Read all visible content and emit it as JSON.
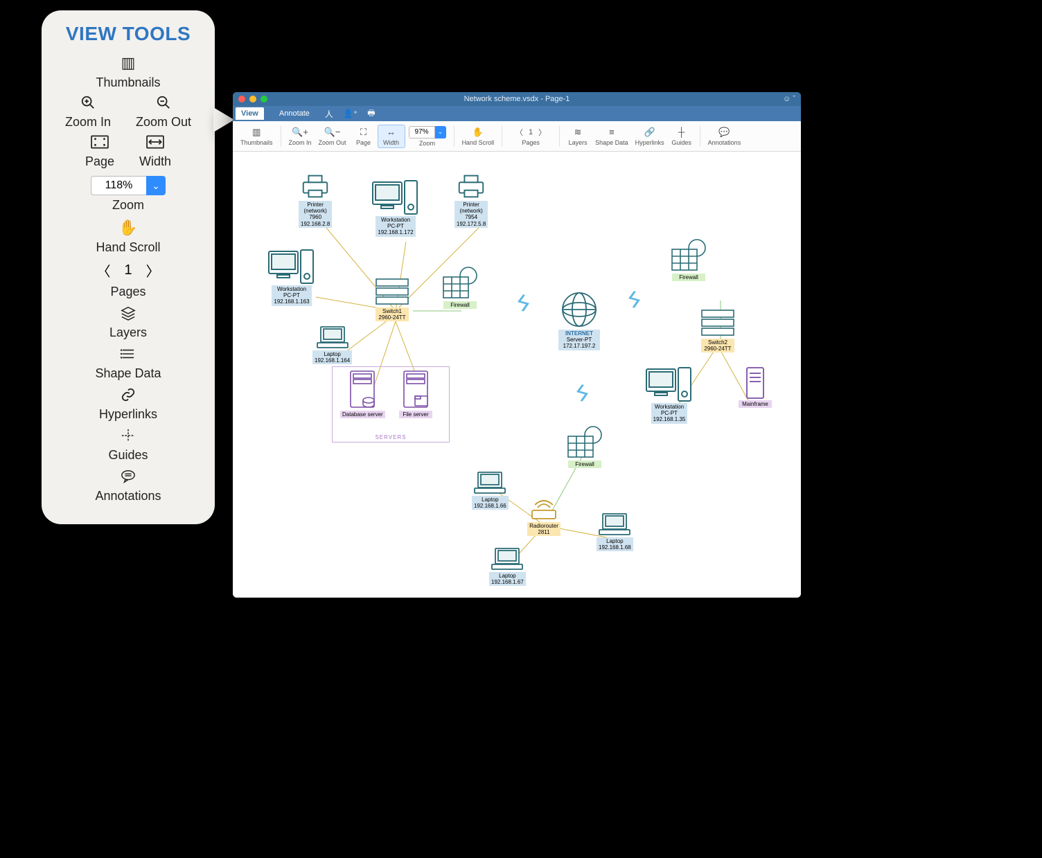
{
  "callout": {
    "title": "VIEW TOOLS",
    "thumbnails": "Thumbnails",
    "zoom_in": "Zoom In",
    "zoom_out": "Zoom Out",
    "page": "Page",
    "width": "Width",
    "zoom_value": "118%",
    "zoom_label": "Zoom",
    "hand_scroll": "Hand Scroll",
    "page_number": "1",
    "pages": "Pages",
    "layers": "Layers",
    "shape_data": "Shape Data",
    "hyperlinks": "Hyperlinks",
    "guides": "Guides",
    "annotations": "Annotations"
  },
  "window": {
    "title": "Network scheme.vsdx - Page-1",
    "menu": {
      "view": "View",
      "annotate": "Annotate"
    },
    "toolbar": {
      "thumbnails": "Thumbnails",
      "zoom_in": "Zoom In",
      "zoom_out": "Zoom Out",
      "page": "Page",
      "width": "Width",
      "zoom_value": "97%",
      "zoom_label": "Zoom",
      "hand_scroll": "Hand Scroll",
      "page_number": "1",
      "pages": "Pages",
      "layers": "Layers",
      "shape_data": "Shape Data",
      "hyperlinks": "Hyperlinks",
      "guides": "Guides",
      "annotations": "Annotations"
    }
  },
  "diagram": {
    "printer1": {
      "l1": "Printer",
      "l2": "(network)",
      "l3": "7960",
      "l4": "192.168.2.8"
    },
    "printer2": {
      "l1": "Printer",
      "l2": "(network)",
      "l3": "7954",
      "l4": "192.172.5.8"
    },
    "ws1": {
      "l1": "Workstation",
      "l2": "PC-PT",
      "l3": "192.168.1.172"
    },
    "ws2": {
      "l1": "Workstation",
      "l2": "PC-PT",
      "l3": "192.168.1.163"
    },
    "ws3": {
      "l1": "Workstation",
      "l2": "PC-PT",
      "l3": "192.168.1.35"
    },
    "switch1": {
      "l1": "Switch1",
      "l2": "2960-24TT"
    },
    "switch2": {
      "l1": "Switch2",
      "l2": "2960-24TT"
    },
    "firewall": "Firewall",
    "laptop1": {
      "l1": "Laptop",
      "l2": "192.168.1.164"
    },
    "laptop2": {
      "l1": "Laptop",
      "l2": "192.168.1.66"
    },
    "laptop3": {
      "l1": "Laptop",
      "l2": "192.168.1.67"
    },
    "laptop4": {
      "l1": "Laptop",
      "l2": "192.168.1.68"
    },
    "dbserver": "Database server",
    "fileserver": "File server",
    "servers_group": "SERVERS",
    "internet": {
      "l1": "INTERNET",
      "l2": "Server-PT",
      "l3": "172.17.197.2"
    },
    "radiorouter": {
      "l1": "Radiorouter",
      "l2": "2811"
    },
    "mainframe": "Mainframe"
  }
}
